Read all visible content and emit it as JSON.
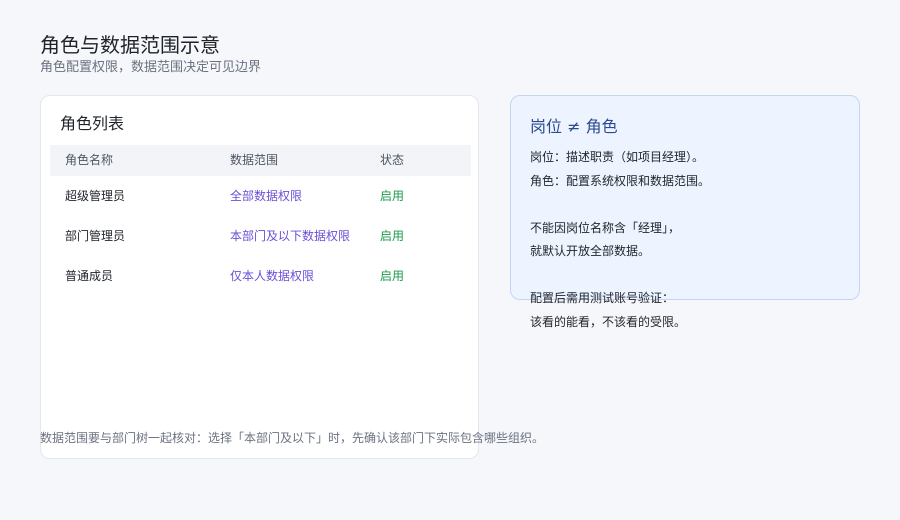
{
  "header": {
    "title": "角色与数据范围示意",
    "subtitle": "角色配置权限，数据范围决定可见边界"
  },
  "roles_card": {
    "title": "角色列表",
    "columns": [
      "角色名称",
      "数据范围",
      "状态"
    ],
    "rows": [
      {
        "name": "超级管理员",
        "scope": "全部数据权限",
        "status": "启用"
      },
      {
        "name": "部门管理员",
        "scope": "本部门及以下数据权限",
        "status": "启用"
      },
      {
        "name": "普通成员",
        "scope": "仅本人数据权限",
        "status": "启用"
      }
    ]
  },
  "info_card": {
    "title": "岗位 ≠ 角色",
    "lines": [
      "岗位：描述职责（如项目经理）。",
      "角色：配置系统权限和数据范围。",
      "",
      "不能因岗位名称含「经理」，",
      "就默认开放全部数据。",
      "",
      "配置后需用测试账号验证：",
      "该看的能看，不该看的受限。"
    ]
  },
  "footer": {
    "note": "数据范围要与部门树一起核对：选择「本部门及以下」时，先确认该部门下实际包含哪些组织。"
  },
  "colors": {
    "background": "#f5f7fb",
    "scope_text": "#6b4fd6",
    "status_enabled": "#1d9a4e",
    "info_background": "#edf4ff",
    "info_border": "#c3d5f5",
    "info_title": "#2b4a8f"
  }
}
